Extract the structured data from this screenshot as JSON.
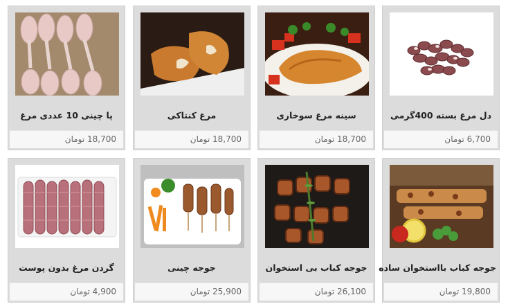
{
  "products": [
    {
      "name": "دل مرغ بسته 400گرمی",
      "price": "6,700 تومان",
      "image_icon": "chicken-hearts-image"
    },
    {
      "name": "سینه مرغ سوخاری",
      "price": "18,700 تومان",
      "image_icon": "fried-chicken-breast-image"
    },
    {
      "name": "مرغ کنتاکی",
      "price": "18,700 تومان",
      "image_icon": "kentucky-chicken-image"
    },
    {
      "name": "پا چینی 10 عددی مرغ",
      "price": "18,700 تومان",
      "image_icon": "chicken-drumsticks-image"
    },
    {
      "name": "جوجه کباب بااستخوان ساده",
      "price": "19,800 تومان",
      "image_icon": "chicken-kebab-bone-image"
    },
    {
      "name": "جوجه کباب بی استخوان",
      "price": "26,100 تومان",
      "image_icon": "boneless-chicken-kebab-image"
    },
    {
      "name": "جوجه چینی",
      "price": "25,900 تومان",
      "image_icon": "chicken-skewers-image"
    },
    {
      "name": "گردن مرغ بدون پوست",
      "price": "4,900 تومان",
      "image_icon": "skinless-chicken-necks-image"
    }
  ]
}
